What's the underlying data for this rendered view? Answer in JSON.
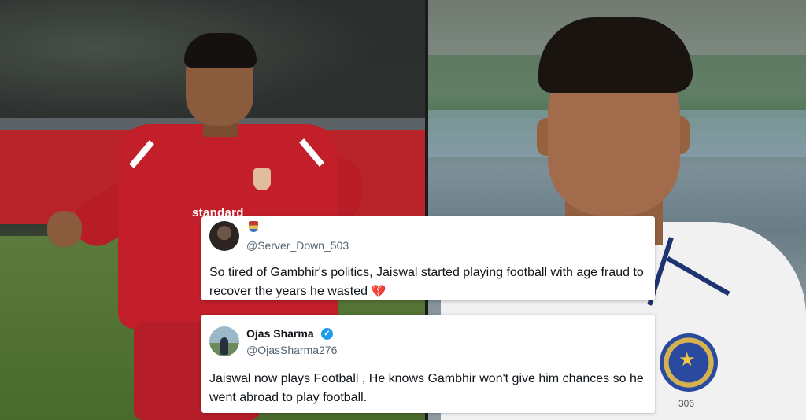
{
  "left_photo": {
    "sponsor_text": "standard"
  },
  "right_photo": {
    "cap_number": "306"
  },
  "tweets": [
    {
      "name": "",
      "handle": "@Server_Down_503",
      "text": "So tired of Gambhir's politics, Jaiswal started playing football with age fraud to recover the years he wasted",
      "emoji": "💔"
    },
    {
      "name": "Ojas Sharma",
      "verified": "✓",
      "handle": "@OjasSharma276",
      "text": "Jaiswal now plays Football , He knows Gambhir won't give him chances so he went abroad to play football."
    }
  ],
  "colors": {
    "liverpool_red": "#c21f2b",
    "india_blue": "#1e3471",
    "verified_blue": "#1d9bf0"
  }
}
